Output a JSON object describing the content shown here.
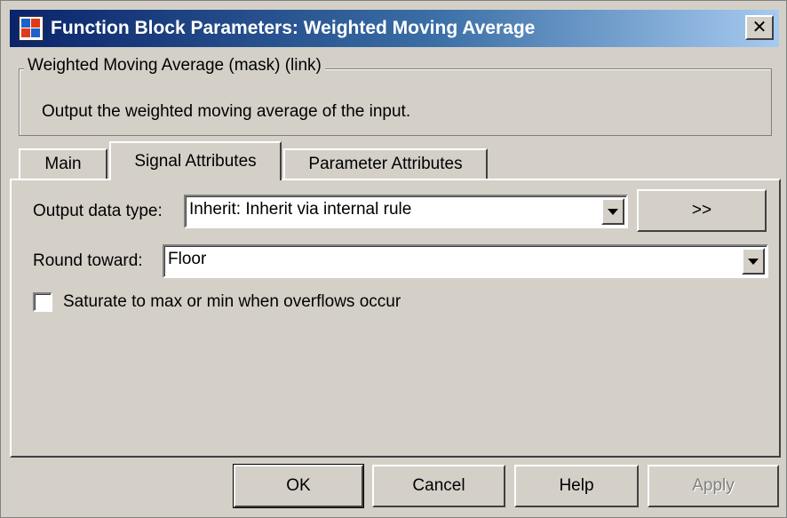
{
  "window": {
    "title": "Function Block Parameters: Weighted Moving Average",
    "close_glyph": "✕",
    "icon": "simulink-block-icon"
  },
  "group": {
    "legend": "Weighted Moving Average (mask) (link)",
    "description": "Output the weighted moving average of the input."
  },
  "tabs": [
    {
      "label": "Main",
      "active": false
    },
    {
      "label": "Signal Attributes",
      "active": true
    },
    {
      "label": "Parameter Attributes",
      "active": false
    }
  ],
  "signal_attributes": {
    "output_data_type": {
      "label": "Output data type:",
      "value": "Inherit: Inherit via internal rule",
      "assistant_button": ">>"
    },
    "round_toward": {
      "label": "Round toward:",
      "value": "Floor"
    },
    "saturate": {
      "label": "Saturate to max or min when overflows occur",
      "checked": false
    }
  },
  "buttons": {
    "ok": "OK",
    "cancel": "Cancel",
    "help": "Help",
    "apply": "Apply"
  }
}
